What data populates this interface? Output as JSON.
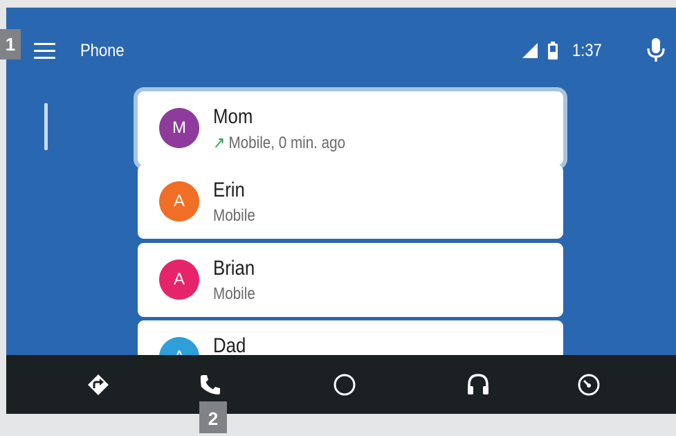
{
  "header": {
    "title": "Phone",
    "time": "1:37",
    "menu_icon": "hamburger-menu-icon",
    "mic_icon": "microphone-icon",
    "signal_icon": "cell-signal-icon",
    "battery_icon": "battery-icon"
  },
  "contacts": [
    {
      "initial": "M",
      "name": "Mom",
      "detail": "Mobile, 0 min. ago",
      "call_type_icon": "outgoing-call-icon",
      "avatar_color": "#8e3b9c",
      "focused": true
    },
    {
      "initial": "A",
      "name": "Erin",
      "detail": "Mobile",
      "avatar_color": "#f06e25"
    },
    {
      "initial": "A",
      "name": "Brian",
      "detail": "Mobile",
      "avatar_color": "#e6246a"
    },
    {
      "initial": "A",
      "name": "Dad",
      "detail": "",
      "avatar_color": "#2e9fd9"
    }
  ],
  "nav": [
    {
      "name": "navigation",
      "icon": "directions-icon"
    },
    {
      "name": "phone",
      "icon": "phone-icon",
      "active": true
    },
    {
      "name": "home",
      "icon": "home-circle-icon"
    },
    {
      "name": "media",
      "icon": "headphones-icon"
    },
    {
      "name": "exit",
      "icon": "speedometer-icon"
    }
  ],
  "callouts": {
    "first": "1",
    "second": "2"
  },
  "colors": {
    "background": "#2a67b1",
    "nav_bar": "#1b2023",
    "focus_ring": "#a8c4e1",
    "callout": "#808285"
  }
}
